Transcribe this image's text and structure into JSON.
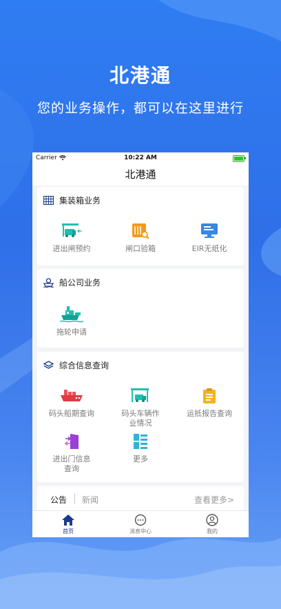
{
  "hero": {
    "title": "北港通",
    "subtitle": "您的业务操作，都可以在这里进行"
  },
  "status_bar": {
    "carrier": "Carrier",
    "time": "10:22 AM"
  },
  "app": {
    "title": "北港通"
  },
  "sections": [
    {
      "title": "集装箱业务",
      "icon": "container-icon",
      "items": [
        {
          "label": "进出闸预约",
          "icon": "truck-gate-icon"
        },
        {
          "label": "闸口验箱",
          "icon": "container-inspect-icon"
        },
        {
          "label": "EIR无纸化",
          "icon": "eir-monitor-icon"
        }
      ]
    },
    {
      "title": "船公司业务",
      "icon": "ship-company-icon",
      "items": [
        {
          "label": "拖轮申请",
          "icon": "tugboat-icon"
        }
      ]
    },
    {
      "title": "综合信息查询",
      "icon": "layers-icon",
      "items": [
        {
          "label": "码头船期查询",
          "icon": "cargo-ship-icon"
        },
        {
          "label": "码头车辆作业情况",
          "label_line1": "码头车辆作",
          "label_line2": "业情况",
          "icon": "truck-crane-icon"
        },
        {
          "label": "运抵报告查询",
          "icon": "clipboard-icon"
        },
        {
          "label": "进出门信息查询",
          "label_line1": "进出门信息",
          "label_line2": "查询",
          "icon": "door-exchange-icon"
        },
        {
          "label": "更多",
          "icon": "more-grid-icon"
        }
      ]
    }
  ],
  "notice": {
    "tab_active": "公告",
    "tab_inactive": "新闻",
    "more": "查看更多>"
  },
  "tabbar": [
    {
      "label": "首页",
      "icon": "home-icon",
      "active": true
    },
    {
      "label": "消息中心",
      "icon": "message-icon",
      "active": false
    },
    {
      "label": "我的",
      "icon": "user-icon",
      "active": false
    }
  ],
  "colors": {
    "primary": "#2f6fe8",
    "accent_teal": "#1fbfb0",
    "accent_orange": "#f39a1c",
    "accent_blue": "#3a86e0",
    "accent_red": "#f0505a",
    "accent_purple": "#9b3fd6",
    "nav_dark": "#1d3a8a"
  }
}
